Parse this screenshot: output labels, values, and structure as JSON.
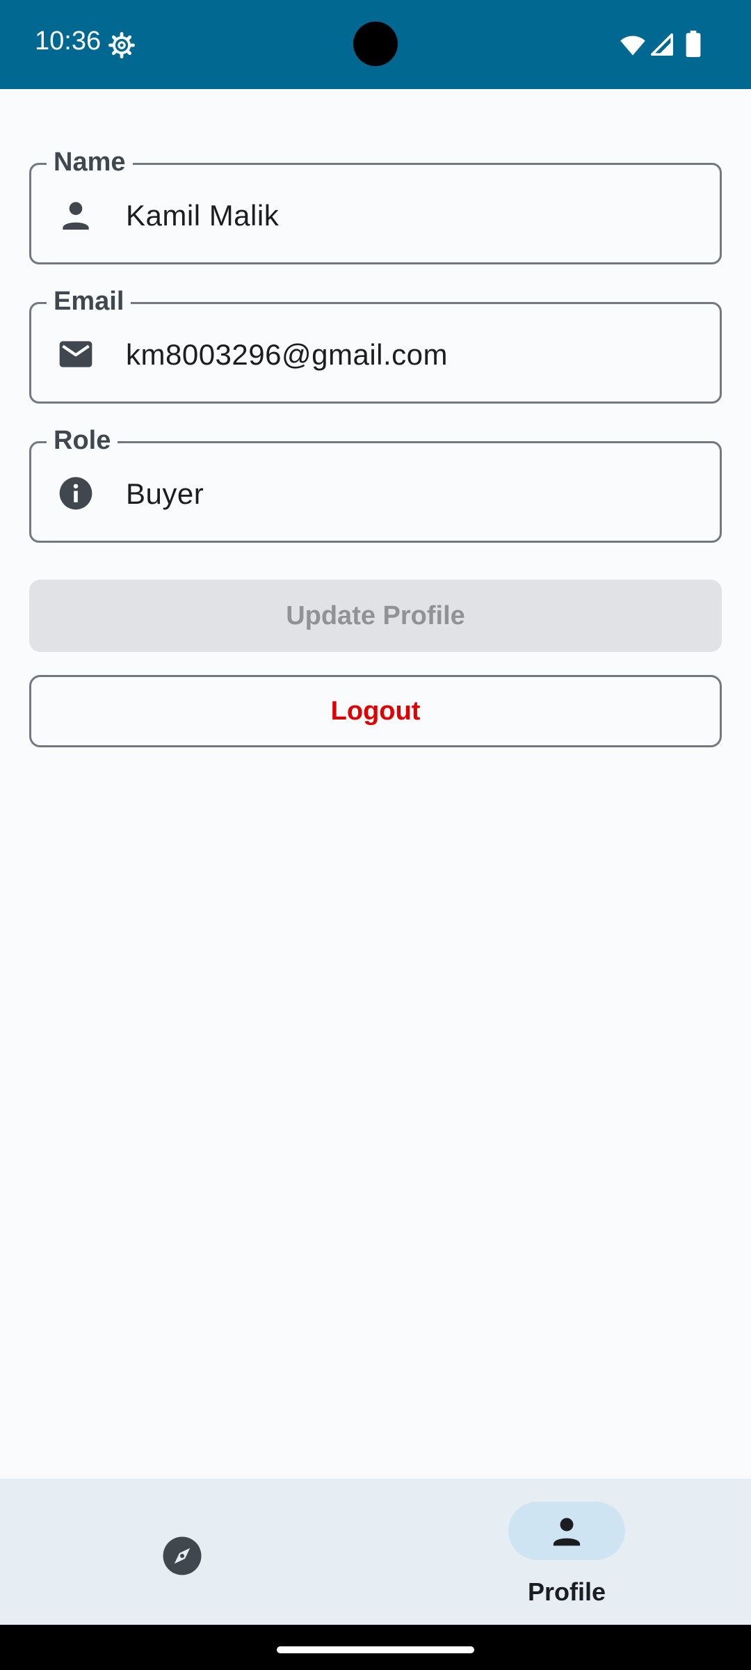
{
  "status_bar": {
    "time": "10:36",
    "icons": [
      "settings-gear-icon",
      "wifi-icon",
      "cell-signal-icon",
      "battery-icon"
    ]
  },
  "profile_form": {
    "name": {
      "label": "Name",
      "value": "Kamil Malik",
      "icon": "person-icon"
    },
    "email": {
      "label": "Email",
      "value": "km8003296@gmail.com",
      "icon": "mail-icon"
    },
    "role": {
      "label": "Role",
      "value": "Buyer",
      "icon": "info-icon"
    }
  },
  "actions": {
    "update_label": "Update Profile",
    "logout_label": "Logout"
  },
  "bottom_nav": {
    "items": [
      {
        "icon": "compass-icon",
        "label": ""
      },
      {
        "icon": "person-icon",
        "label": "Profile",
        "selected": true
      }
    ]
  },
  "colors": {
    "status_bar": "#006891",
    "logout_text": "#e00000",
    "nav_background": "#e6edf3",
    "nav_selected_pill": "#cfe4f3"
  }
}
